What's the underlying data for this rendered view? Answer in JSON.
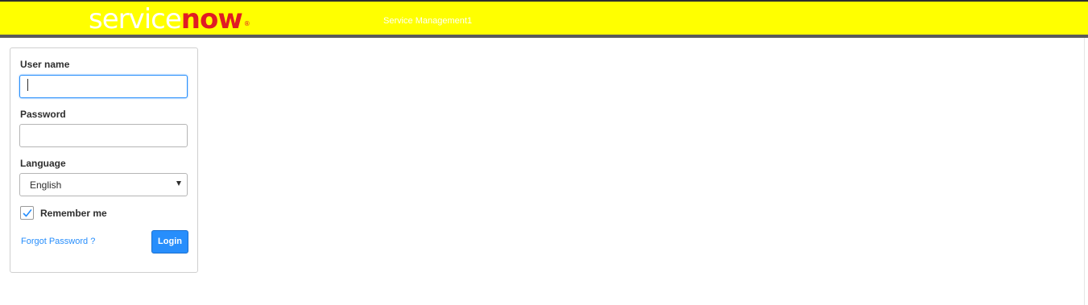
{
  "header": {
    "logo": {
      "part1": "service",
      "part2": "now",
      "mark": "®"
    },
    "instance_name": "Service Management1",
    "colors": {
      "background": "#ffff00",
      "bottom_bar": "#5a5a5a",
      "logo_now": "#e01b24"
    }
  },
  "login_form": {
    "username": {
      "label": "User name",
      "value": "",
      "placeholder": ""
    },
    "password": {
      "label": "Password",
      "value": "",
      "placeholder": ""
    },
    "language": {
      "label": "Language",
      "selected": "English"
    },
    "remember_me": {
      "label": "Remember me",
      "checked": true
    },
    "forgot_password": {
      "label": "Forgot Password ?"
    },
    "login_button": {
      "label": "Login"
    },
    "colors": {
      "accent": "#278efc"
    }
  }
}
